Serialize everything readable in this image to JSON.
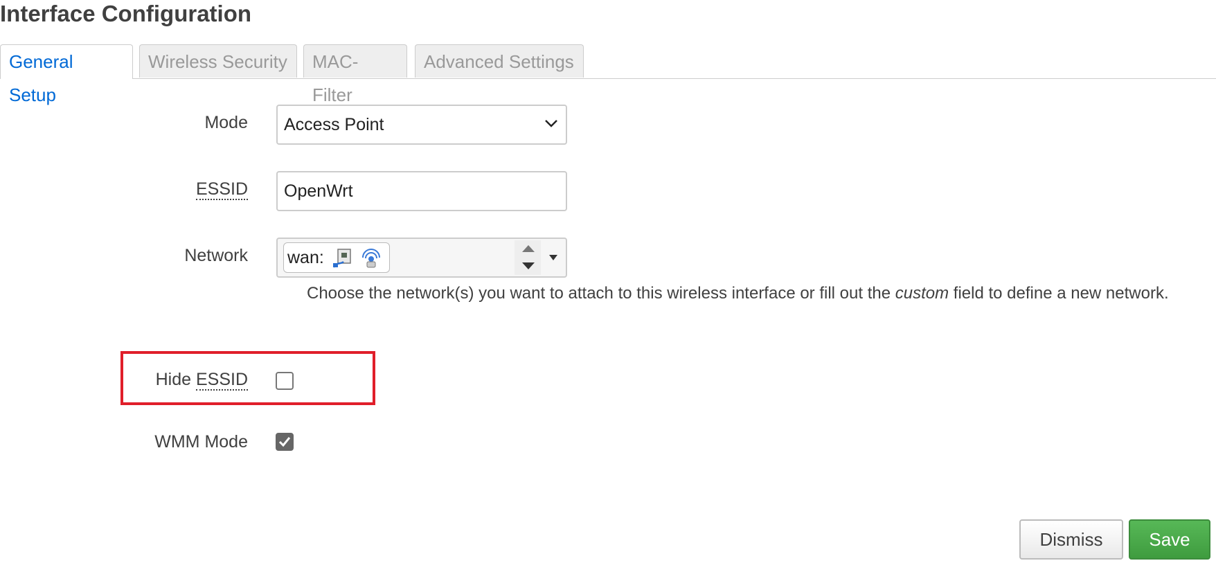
{
  "page": {
    "title": "Interface Configuration"
  },
  "tabs": [
    {
      "label": "General Setup",
      "active": true
    },
    {
      "label": "Wireless Security",
      "active": false
    },
    {
      "label": "MAC-Filter",
      "active": false
    },
    {
      "label": "Advanced Settings",
      "active": false
    }
  ],
  "form": {
    "mode": {
      "label": "Mode",
      "value": "Access Point",
      "icon": "chevron-down-icon"
    },
    "essid": {
      "label": "ESSID",
      "value": "OpenWrt"
    },
    "network": {
      "label": "Network",
      "chip_text": "wan:",
      "chip_icons": [
        "ethernet-port-icon",
        "wireless-icon"
      ],
      "help_before": "Choose the network(s) you want to attach to this wireless interface or fill out the ",
      "help_em": "custom",
      "help_after": " field to define a new network."
    },
    "hide_essid": {
      "label_prefix": "Hide ",
      "label_abbr": "ESSID",
      "checked": false
    },
    "wmm_mode": {
      "label": "WMM Mode",
      "checked": true
    }
  },
  "actions": {
    "dismiss_label": "Dismiss",
    "save_label": "Save"
  },
  "colors": {
    "active_tab": "#0069d6",
    "save_button": "#47a447",
    "highlight_border": "#e01e2a"
  }
}
